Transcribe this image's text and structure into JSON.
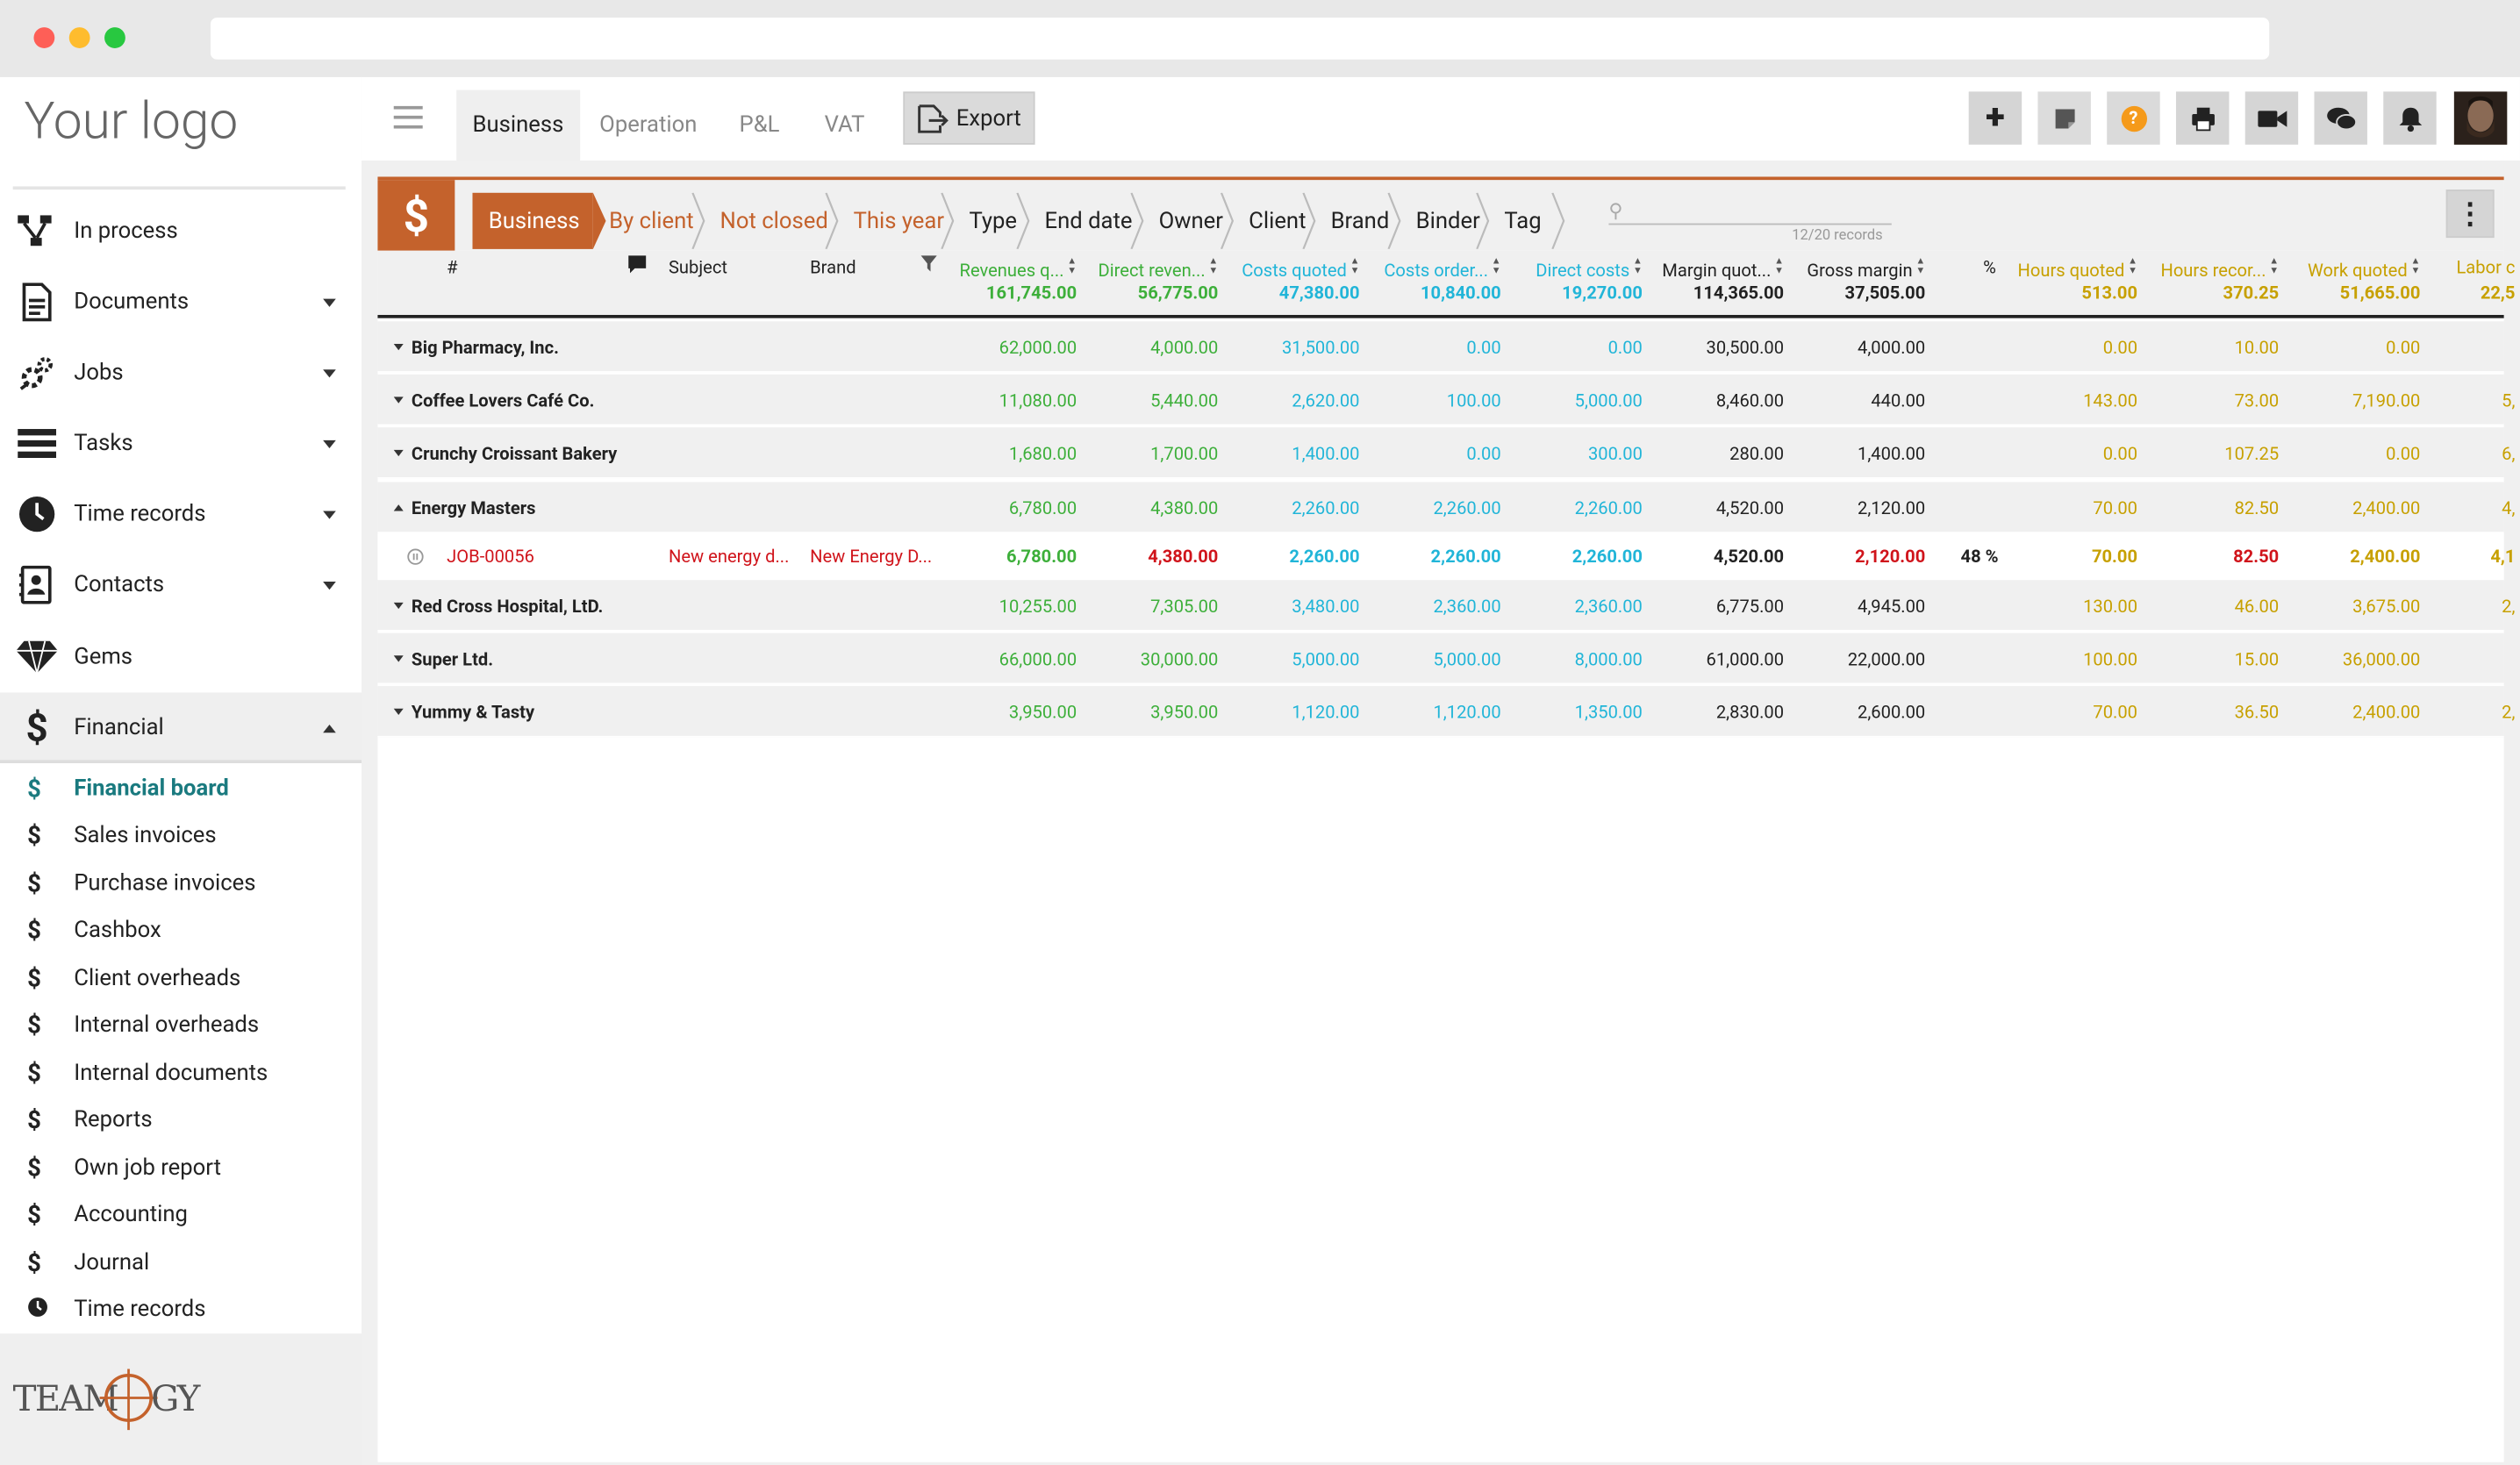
{
  "sidebar": {
    "logo": "Your logo",
    "items": [
      {
        "label": "In process",
        "icon": "process-icon",
        "caret": ""
      },
      {
        "label": "Documents",
        "icon": "document-icon",
        "caret": "down"
      },
      {
        "label": "Jobs",
        "icon": "jobs-icon",
        "caret": "down"
      },
      {
        "label": "Tasks",
        "icon": "tasks-icon",
        "caret": "down"
      },
      {
        "label": "Time records",
        "icon": "clock-icon",
        "caret": "down"
      },
      {
        "label": "Contacts",
        "icon": "contacts-icon",
        "caret": "down"
      },
      {
        "label": "Gems",
        "icon": "gem-icon",
        "caret": ""
      },
      {
        "label": "Financial",
        "icon": "dollar-icon",
        "caret": "up"
      }
    ],
    "subitems": [
      {
        "label": "Financial board",
        "icon": "$"
      },
      {
        "label": "Sales invoices",
        "icon": "$"
      },
      {
        "label": "Purchase invoices",
        "icon": "$"
      },
      {
        "label": "Cashbox",
        "icon": "$"
      },
      {
        "label": "Client overheads",
        "icon": "$"
      },
      {
        "label": "Internal overheads",
        "icon": "$"
      },
      {
        "label": "Internal documents",
        "icon": "$"
      },
      {
        "label": "Reports",
        "icon": "$"
      },
      {
        "label": "Own job report",
        "icon": "$"
      },
      {
        "label": "Accounting",
        "icon": "$"
      },
      {
        "label": "Journal",
        "icon": "$"
      },
      {
        "label": "Time records",
        "icon": "clock"
      }
    ],
    "brand": "TEAMOGY"
  },
  "topbar": {
    "tabs": [
      "Business",
      "Operation",
      "P&L",
      "VAT"
    ],
    "export_label": "Export",
    "icons": [
      "plus-icon",
      "note-icon",
      "help-icon",
      "print-icon",
      "video-icon",
      "chat-icon",
      "bell-icon"
    ]
  },
  "filters": {
    "dollar": "$",
    "crumbs": [
      "Business",
      "By client",
      "Not closed",
      "This year",
      "Type",
      "End date",
      "Owner",
      "Client",
      "Brand",
      "Binder",
      "Tag"
    ],
    "records": "12/20 records"
  },
  "colors": {
    "accent": "#c4622c",
    "teal": "#1a7a7f",
    "green": "#3daf3a",
    "blue": "#21b5d8",
    "gold": "#c7a000",
    "red": "#d0141b"
  },
  "table": {
    "columns": [
      {
        "label": "#"
      },
      {
        "label": "Subject"
      },
      {
        "label": "Brand"
      },
      {
        "label": "Revenues q...",
        "total": "161,745.00"
      },
      {
        "label": "Direct reven...",
        "total": "56,775.00"
      },
      {
        "label": "Costs quoted",
        "total": "47,380.00"
      },
      {
        "label": "Costs order...",
        "total": "10,840.00"
      },
      {
        "label": "Direct costs",
        "total": "19,270.00"
      },
      {
        "label": "Margin quot...",
        "total": "114,365.00"
      },
      {
        "label": "Gross margin",
        "total": "37,505.00"
      },
      {
        "label": "%"
      },
      {
        "label": "Hours quoted",
        "total": "513.00"
      },
      {
        "label": "Hours recor...",
        "total": "370.25"
      },
      {
        "label": "Work quoted",
        "total": "51,665.00"
      },
      {
        "label": "Labor c",
        "total": "22,5"
      }
    ],
    "rows": [
      {
        "name": "Big Pharmacy, Inc.",
        "open": false,
        "v": [
          "62,000.00",
          "4,000.00",
          "31,500.00",
          "0.00",
          "0.00",
          "30,500.00",
          "4,000.00",
          "",
          "0.00",
          "10.00",
          "0.00",
          ""
        ]
      },
      {
        "name": "Coffee Lovers Café Co.",
        "open": false,
        "v": [
          "11,080.00",
          "5,440.00",
          "2,620.00",
          "100.00",
          "5,000.00",
          "8,460.00",
          "440.00",
          "",
          "143.00",
          "73.00",
          "7,190.00",
          "5,"
        ]
      },
      {
        "name": "Crunchy Croissant Bakery",
        "open": false,
        "v": [
          "1,680.00",
          "1,700.00",
          "1,400.00",
          "0.00",
          "300.00",
          "280.00",
          "1,400.00",
          "",
          "0.00",
          "107.25",
          "0.00",
          "6,"
        ]
      },
      {
        "name": "Energy Masters",
        "open": true,
        "v": [
          "6,780.00",
          "4,380.00",
          "2,260.00",
          "2,260.00",
          "2,260.00",
          "4,520.00",
          "2,120.00",
          "",
          "70.00",
          "82.50",
          "2,400.00",
          "4,"
        ]
      },
      {
        "job": true,
        "id": "JOB-00056",
        "subject": "New energy d...",
        "brand": "New Energy D...",
        "v": [
          "6,780.00",
          "4,380.00",
          "2,260.00",
          "2,260.00",
          "2,260.00",
          "4,520.00",
          "2,120.00",
          "48 %",
          "70.00",
          "82.50",
          "2,400.00",
          "4,1"
        ]
      },
      {
        "name": "Red Cross Hospital, LtD.",
        "open": false,
        "v": [
          "10,255.00",
          "7,305.00",
          "3,480.00",
          "2,360.00",
          "2,360.00",
          "6,775.00",
          "4,945.00",
          "",
          "130.00",
          "46.00",
          "3,675.00",
          "2,"
        ]
      },
      {
        "name": "Super Ltd.",
        "open": false,
        "v": [
          "66,000.00",
          "30,000.00",
          "5,000.00",
          "5,000.00",
          "8,000.00",
          "61,000.00",
          "22,000.00",
          "",
          "100.00",
          "15.00",
          "36,000.00",
          ""
        ]
      },
      {
        "name": "Yummy & Tasty",
        "open": false,
        "v": [
          "3,950.00",
          "3,950.00",
          "1,120.00",
          "1,120.00",
          "1,350.00",
          "2,830.00",
          "2,600.00",
          "",
          "70.00",
          "36.50",
          "2,400.00",
          "2,"
        ]
      }
    ]
  }
}
